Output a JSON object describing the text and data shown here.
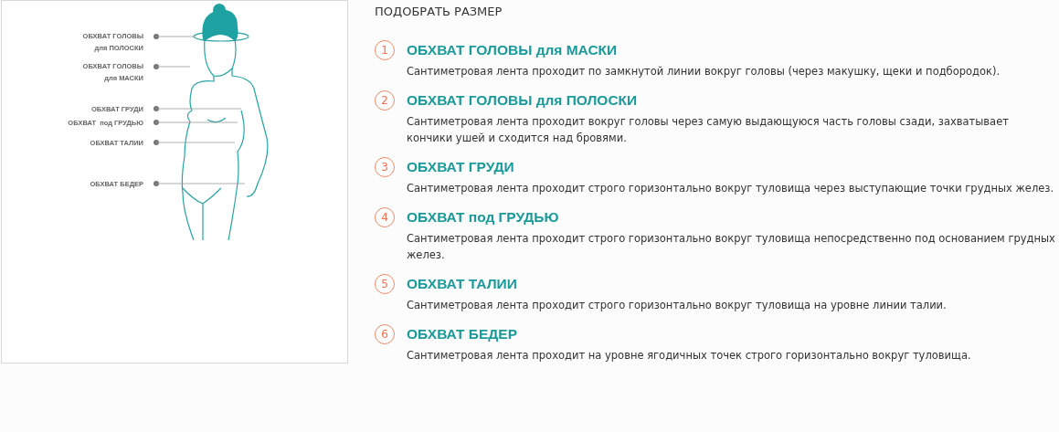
{
  "diagram": {
    "labels": [
      "ОБХВАТ ГОЛОВЫ для ПОЛОСКИ",
      "ОБХВАТ ГОЛОВЫ для МАСКИ",
      "ОБХВАТ ГРУДИ",
      "ОБХВАТ  под ГРУДЬЮ",
      "ОБХВАТ ТАЛИИ",
      "ОБХВАТ БЕДЕР"
    ]
  },
  "heading": "ПОДОБРАТЬ РАЗМЕР",
  "steps": [
    {
      "number": "1",
      "title": "ОБХВАТ ГОЛОВЫ для МАСКИ",
      "text": "Сантиметровая лента проходит по замкнутой линии вокруг головы (через макушку, щеки и подбородок)."
    },
    {
      "number": "2",
      "title": "ОБХВАТ ГОЛОВЫ для ПОЛОСКИ",
      "text": "Сантиметровая лента проходит вокруг головы через самую выдающуюся часть головы сзади, захватывает кончики ушей и сходится над бровями."
    },
    {
      "number": "3",
      "title": "ОБХВАТ ГРУДИ",
      "text": "Сантиметровая лента проходит строго горизонтально вокруг туловища через выступающие точки грудных желез."
    },
    {
      "number": "4",
      "title": "ОБХВАТ под ГРУДЬЮ",
      "text": "Сантиметровая лента проходит строго горизонтально вокруг туловища непосредственно под основанием грудных желез."
    },
    {
      "number": "5",
      "title": "ОБХВАТ ТАЛИИ",
      "text": "Сантиметровая лента проходит строго горизонтально вокруг туловища на уровне линии талии."
    },
    {
      "number": "6",
      "title": "ОБХВАТ БЕДЕР",
      "text": "Сантиметровая лента проходит на уровне ягодичных точек строго горизонтально вокруг туловища."
    }
  ]
}
